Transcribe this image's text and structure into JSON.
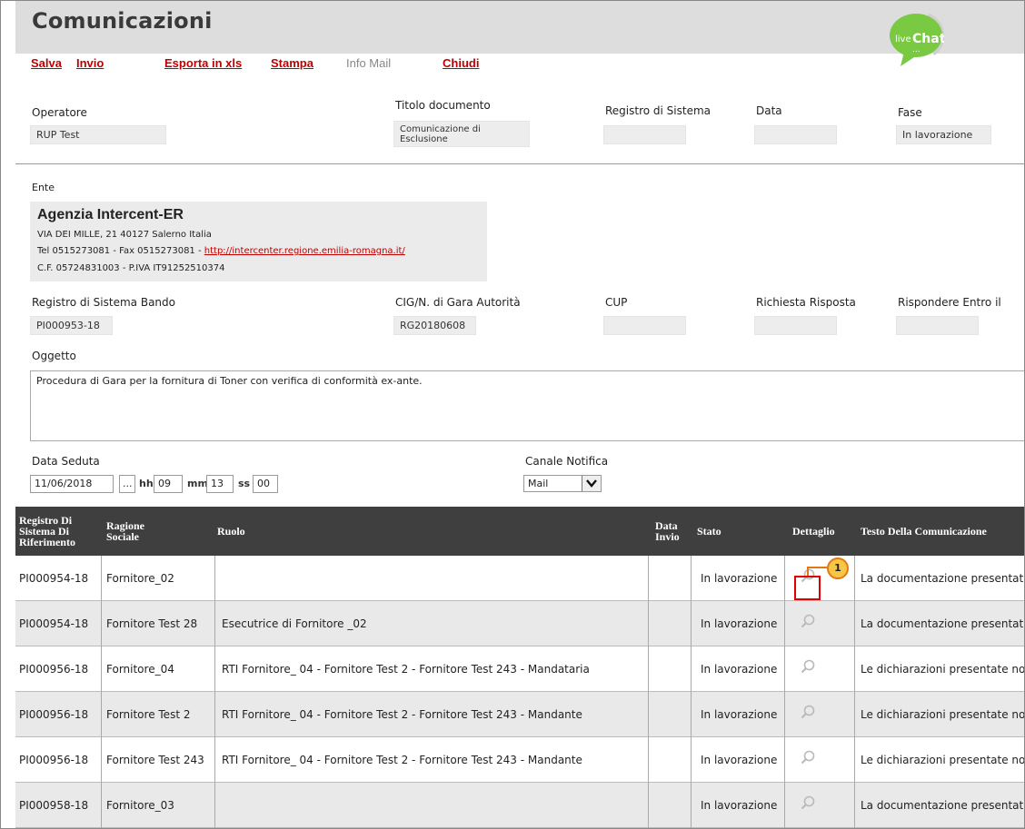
{
  "header": {
    "title": "Comunicazioni",
    "toolbar": {
      "salva": "Salva",
      "invio": "Invio",
      "esporta": "Esporta in xls",
      "stampa": "Stampa",
      "info_mail": "Info Mail",
      "chiudi": "Chiudi"
    },
    "livechat": {
      "live": "live",
      "chat": "Chat",
      "dots": "..."
    }
  },
  "form": {
    "operatore": {
      "label": "Operatore",
      "value": "RUP Test"
    },
    "titolo": {
      "label": "Titolo documento",
      "value_line1": "Comunicazione di",
      "value_line2": "Esclusione"
    },
    "registro": {
      "label": "Registro di Sistema",
      "value": ""
    },
    "data": {
      "label": "Data",
      "value": ""
    },
    "fase": {
      "label": "Fase",
      "value": "In lavorazione"
    },
    "ente": {
      "label": "Ente",
      "name": "Agenzia Intercent-ER",
      "address": "VIA DEI MILLE, 21 40127 Salerno Italia",
      "tel_prefix": "Tel 0515273081 - Fax 0515273081 - ",
      "link": "http://intercenter.regione.emilia-romagna.it/",
      "cf": "C.F. 05724831003 - P.IVA IT91252510374"
    },
    "registro_bando": {
      "label": "Registro di Sistema Bando",
      "value": "PI000953-18"
    },
    "cig": {
      "label": "CIG/N. di Gara Autorità",
      "value": "RG20180608"
    },
    "cup": {
      "label": "CUP",
      "value": ""
    },
    "richiesta": {
      "label": "Richiesta Risposta",
      "value": ""
    },
    "rispondere": {
      "label": "Rispondere Entro il",
      "value": ""
    },
    "oggetto": {
      "label": "Oggetto",
      "value": "Procedura di Gara per la fornitura di Toner con verifica di conformità ex-ante."
    },
    "data_seduta": {
      "label": "Data Seduta",
      "date": "11/06/2018",
      "picker": "...",
      "hh_label": "hh",
      "hh": "09",
      "mm_label": "mm",
      "mm": "13",
      "ss_label": "ss",
      "ss": "00"
    },
    "canale": {
      "label": "Canale Notifica",
      "selected": "Mail"
    }
  },
  "table": {
    "headers": {
      "registro_l1": "Registro Di",
      "registro_l2": "Sistema Di",
      "registro_l3": "Riferimento",
      "ragione_l1": "Ragione",
      "ragione_l2": "Sociale",
      "ruolo": "Ruolo",
      "data_l1": "Data",
      "data_l2": "Invio",
      "stato": "Stato",
      "dettaglio": "Dettaglio",
      "testo": "Testo Della Comunicazione"
    },
    "rows": [
      {
        "registro": "PI000954-18",
        "ragione": "Fornitore_02",
        "ruolo": "",
        "data": "",
        "stato": "In lavorazione",
        "testo": "La documentazione presentata"
      },
      {
        "registro": "PI000954-18",
        "ragione": "Fornitore Test 28",
        "ruolo": "Esecutrice di Fornitore _02",
        "data": "",
        "stato": "In lavorazione",
        "testo": "La documentazione presentata"
      },
      {
        "registro": "PI000956-18",
        "ragione": "Fornitore_04",
        "ruolo": "RTI Fornitore_ 04 - Fornitore Test 2 - Fornitore Test 243 - Mandataria",
        "data": "",
        "stato": "In lavorazione",
        "testo": "Le dichiarazioni presentate non"
      },
      {
        "registro": "PI000956-18",
        "ragione": "Fornitore Test 2",
        "ruolo": "RTI Fornitore_ 04 - Fornitore Test 2 - Fornitore Test 243 - Mandante",
        "data": "",
        "stato": "In lavorazione",
        "testo": "Le dichiarazioni presentate non"
      },
      {
        "registro": "PI000956-18",
        "ragione": "Fornitore Test 243",
        "ruolo": "RTI Fornitore_ 04 - Fornitore Test 2 - Fornitore Test 243 - Mandante",
        "data": "",
        "stato": "In lavorazione",
        "testo": "Le dichiarazioni presentate non"
      },
      {
        "registro": "PI000958-18",
        "ragione": "Fornitore_03",
        "ruolo": "",
        "data": "",
        "stato": "In lavorazione",
        "testo": "La documentazione presentata"
      }
    ]
  },
  "callout": {
    "number": "1"
  },
  "colors": {
    "accent_red": "#c00000",
    "header_dark": "#3f3f3f",
    "badge": "#f7c646",
    "livechat": "#7ac943"
  }
}
